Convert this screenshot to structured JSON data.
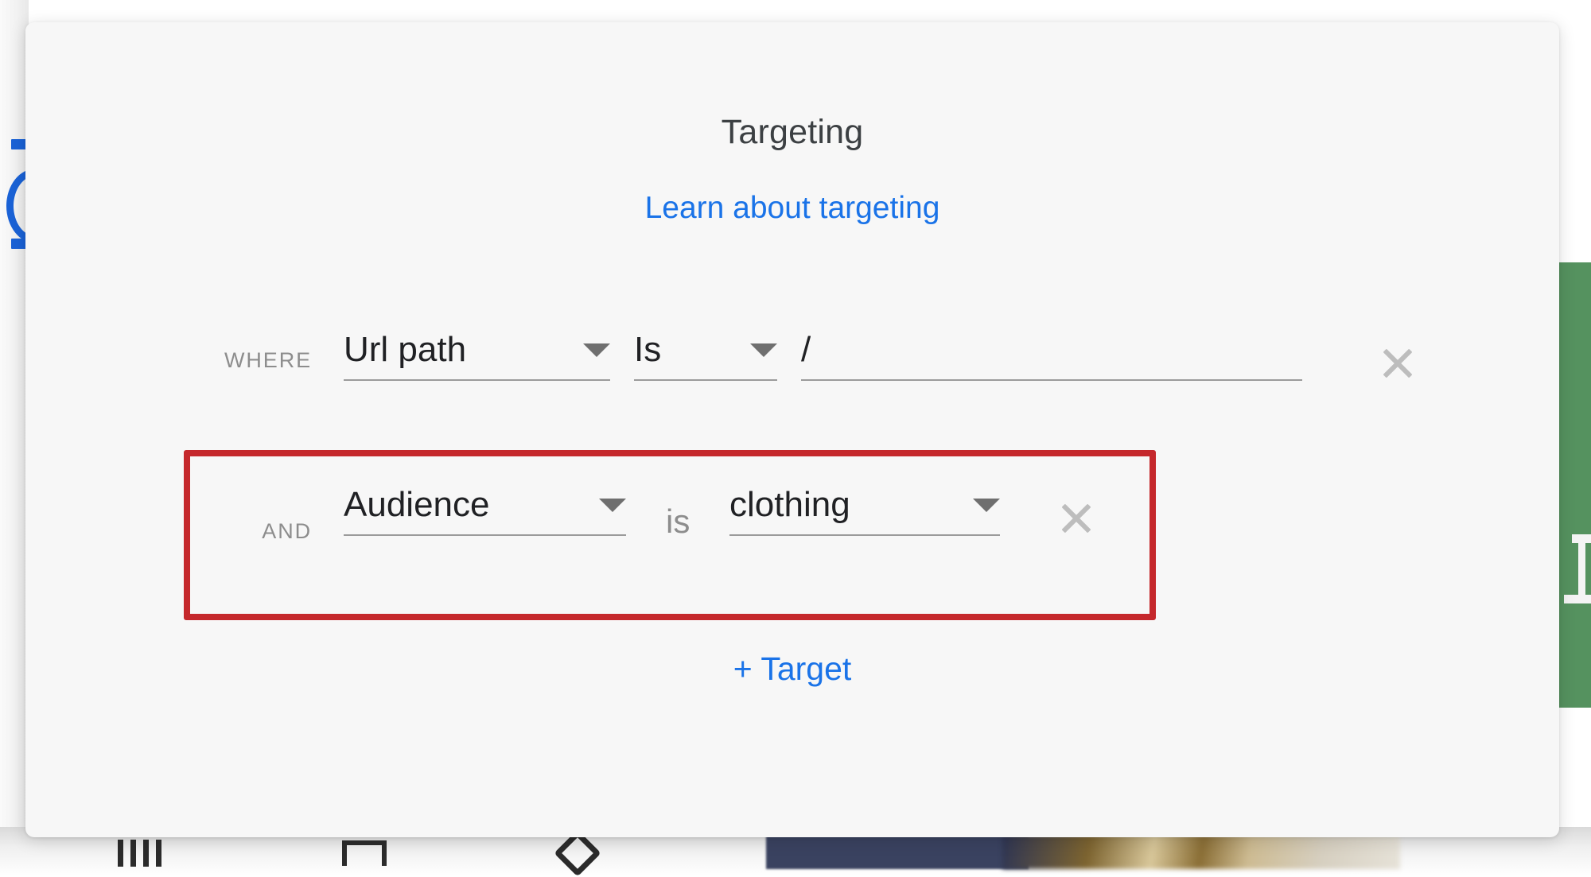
{
  "background": {
    "left_rail": "left-navigation-rail",
    "right_panel_color": "#55925f",
    "bottom_toolbar": {
      "icons": [
        "columns-icon",
        "square-icon",
        "diamond-icon"
      ]
    }
  },
  "dialog": {
    "title": "Targeting",
    "learn_link": "Learn about targeting",
    "add_target_label": "+ Target",
    "background_color": "#f7f7f7",
    "link_color": "#1a73e8",
    "title_color": "#3c4043"
  },
  "rules": [
    {
      "conjunction": "WHERE",
      "attribute": "Url path",
      "operator": "Is",
      "value": "/",
      "attribute_caret": "chevron-down-icon",
      "operator_caret": "chevron-down-icon",
      "remove": "close-icon",
      "value_is_dropdown": false,
      "highlighted": false
    },
    {
      "conjunction": "AND",
      "attribute": "Audience",
      "operator": "is",
      "value": "clothing",
      "attribute_caret": "chevron-down-icon",
      "value_caret": "chevron-down-icon",
      "remove": "close-icon",
      "value_is_dropdown": true,
      "highlighted": true
    }
  ],
  "annotation": {
    "type": "highlight-rectangle",
    "color": "#c5282c",
    "targets": "second-condition-row"
  }
}
